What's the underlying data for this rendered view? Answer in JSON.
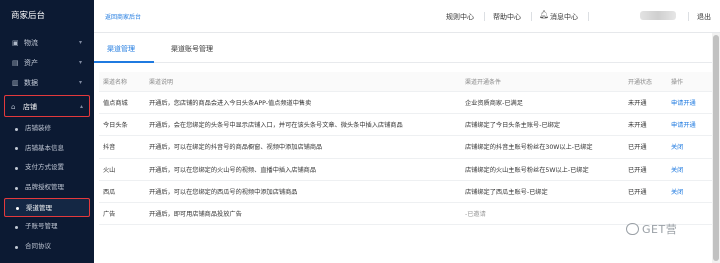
{
  "sidebar": {
    "brand": "商家后台",
    "items": [
      {
        "icon": "logistics-icon",
        "glyph": "▣",
        "label": "物流"
      },
      {
        "icon": "assets-icon",
        "glyph": "▤",
        "label": "资产"
      },
      {
        "icon": "data-icon",
        "glyph": "▥",
        "label": "数据"
      }
    ],
    "store": {
      "icon": "store-icon",
      "glyph": "⌂",
      "label": "店铺"
    },
    "store_sub": [
      "店铺装修",
      "店铺基本信息",
      "支付方式设置",
      "品牌授权管理",
      "渠道管理",
      "子账号管理",
      "合同协议"
    ]
  },
  "topbar": {
    "back": "返回商家后台",
    "rules": "规则中心",
    "help": "帮助中心",
    "messages": "消息中心",
    "logout": "退出"
  },
  "tabs": [
    "渠道管理",
    "渠道账号管理"
  ],
  "table": {
    "headers": [
      "渠道名称",
      "渠道说明",
      "渠道开通条件",
      "开通状态",
      "操作"
    ],
    "rows": [
      {
        "name": "值点商城",
        "desc": "开通后，您店铺的商品会进入今日头条APP-值点频道中售卖",
        "cond": "企业资质商家-已满足",
        "status": "未开通",
        "action": "申请开通"
      },
      {
        "name": "今日头条",
        "desc": "开通后，会在您绑定的头条号中显示店铺入口，并可在该头条号文章、微头条中插入店铺商品",
        "cond": "店铺绑定了今日头条主账号-已绑定",
        "status": "未开通",
        "action": "申请开通"
      },
      {
        "name": "抖音",
        "desc": "开通后，可以在绑定的抖音号的商品橱窗、视频中添加店铺商品",
        "cond": "店铺绑定的抖音主账号粉丝在30W以上-已绑定",
        "status": "已开通",
        "action": "关闭"
      },
      {
        "name": "火山",
        "desc": "开通后，可以在您绑定的火山号的视频、直播中插入店铺商品",
        "cond": "店铺绑定的火山主账号粉丝在5W以上-已绑定",
        "status": "已开通",
        "action": "关闭"
      },
      {
        "name": "西瓜",
        "desc": "开通后，可以在您绑定的西瓜号的视频中添加店铺商品",
        "cond": "店铺绑定了西瓜主账号-已绑定",
        "status": "已开通",
        "action": "关闭"
      },
      {
        "name": "广告",
        "desc": "开通后，即可用店铺商品投放广告",
        "cond": "-已邀请",
        "status": "",
        "action": ""
      }
    ]
  },
  "watermark": "GET营"
}
